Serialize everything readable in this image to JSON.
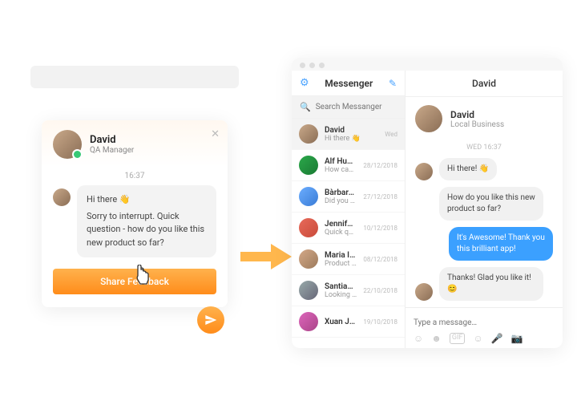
{
  "widget": {
    "name": "David",
    "role": "QA Manager",
    "time": "16:37",
    "greeting": "Hi there 👋",
    "message": "Sorry to interrupt. Quick question - how do you like this new product so far?",
    "cta": "Share Feedback"
  },
  "messenger": {
    "title": "Messenger",
    "search_placeholder": "Search Messanger",
    "conversations": [
      {
        "name": "David",
        "preview": "Hi there 👋",
        "time": "Wed"
      },
      {
        "name": "Alf Huncoot",
        "preview": "How can I help you?",
        "time": "28/12/2018"
      },
      {
        "name": "Bàrbara Co…",
        "preview": "Did you know that…",
        "time": "27/12/2018"
      },
      {
        "name": "Jennifer Re…",
        "preview": "Quick question - how",
        "time": "10/12/2018"
      },
      {
        "name": "Maria Illes…",
        "preview": "Product so far…",
        "time": "08/12/2018"
      },
      {
        "name": "Santiago…",
        "preview": "Looking for a place…",
        "time": "22/10/2018"
      },
      {
        "name": "Xuan Jingyi",
        "preview": "",
        "time": "19/10/2018"
      }
    ]
  },
  "chat": {
    "header": "David",
    "profile_name": "David",
    "profile_sub": "Local Business",
    "day": "WED 16:37",
    "messages": [
      {
        "side": "left",
        "text": "Hi there! 👋"
      },
      {
        "side": "left",
        "text": "How do you like this new product so far?"
      },
      {
        "side": "right",
        "text": "It's Awesome! Thank you this brilliant app!"
      },
      {
        "side": "left",
        "text": "Thanks! Glad you like it! 😊"
      }
    ],
    "compose_placeholder": "Type a message…"
  }
}
